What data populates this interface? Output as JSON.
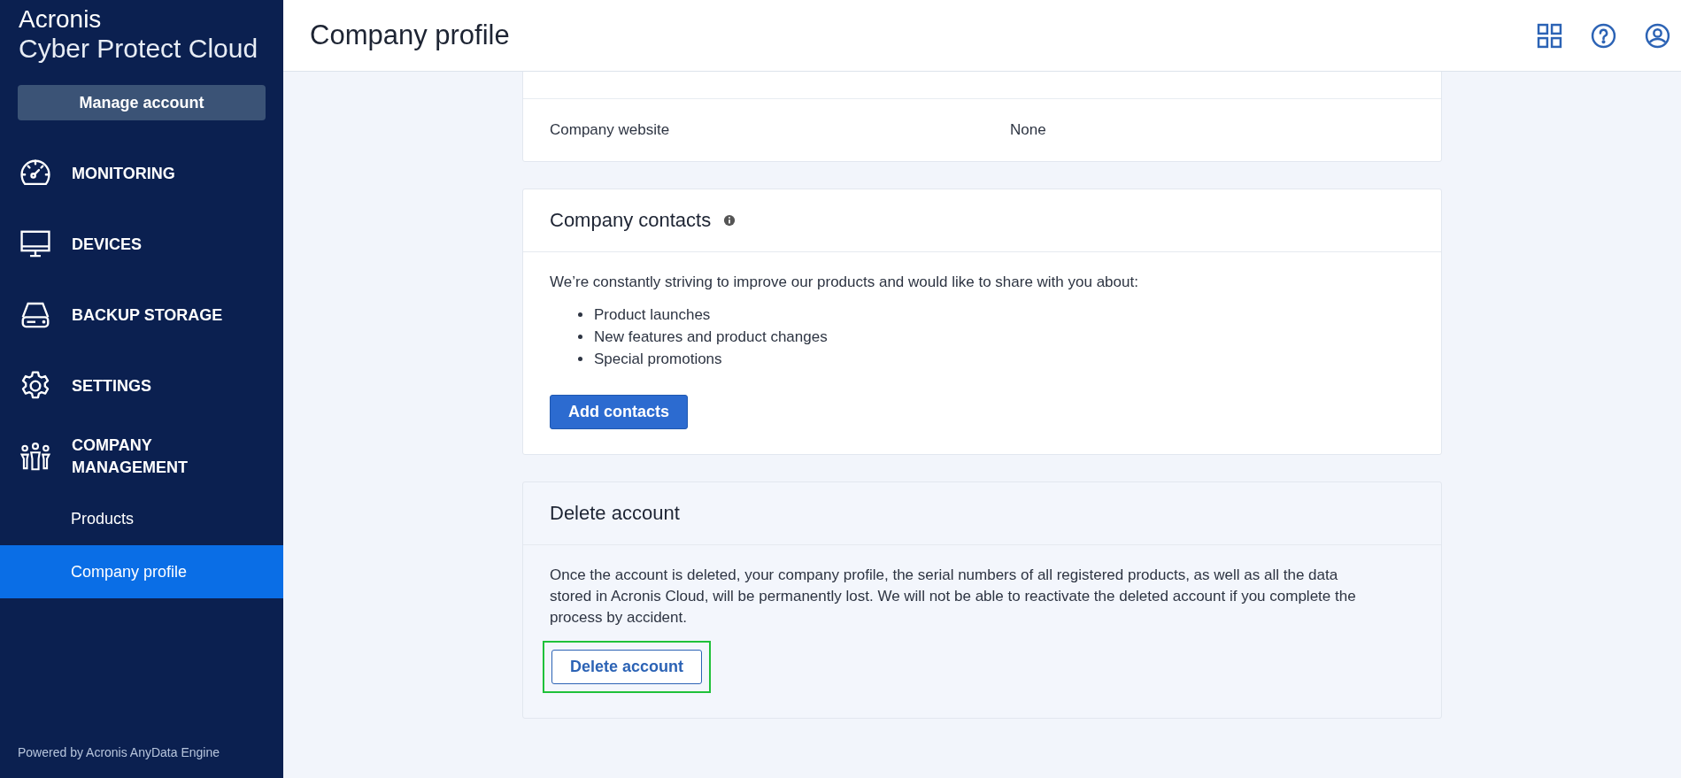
{
  "sidebar": {
    "brand": "Acronis",
    "product": "Cyber Protect Cloud",
    "manage_button": "Manage account",
    "nav": [
      {
        "label": "MONITORING",
        "selected": false
      },
      {
        "label": "DEVICES",
        "selected": false
      },
      {
        "label": "BACKUP STORAGE",
        "selected": false
      },
      {
        "label": "SETTINGS",
        "selected": false
      },
      {
        "label": "COMPANY MANAGEMENT",
        "selected": false,
        "children": [
          {
            "label": "Products",
            "selected": false
          },
          {
            "label": "Company profile",
            "selected": true
          }
        ]
      }
    ],
    "footer": "Powered by Acronis AnyData Engine"
  },
  "header": {
    "title": "Company profile"
  },
  "profile_rows": [
    {
      "label": "Company website",
      "value": "None"
    }
  ],
  "contacts": {
    "title": "Company contacts",
    "text": "We’re constantly striving to improve our products and would like to share with you about:",
    "bullets": [
      "Product launches",
      "New features and product changes",
      "Special promotions"
    ],
    "button": "Add contacts"
  },
  "delete": {
    "title": "Delete account",
    "text": "Once the account is deleted, your company profile, the serial numbers of all registered products, as well as all the data stored in Acronis Cloud, will be permanently lost. We will not be able to reactivate the deleted account if you complete the process by accident.",
    "button": "Delete account",
    "highlighted": true
  }
}
